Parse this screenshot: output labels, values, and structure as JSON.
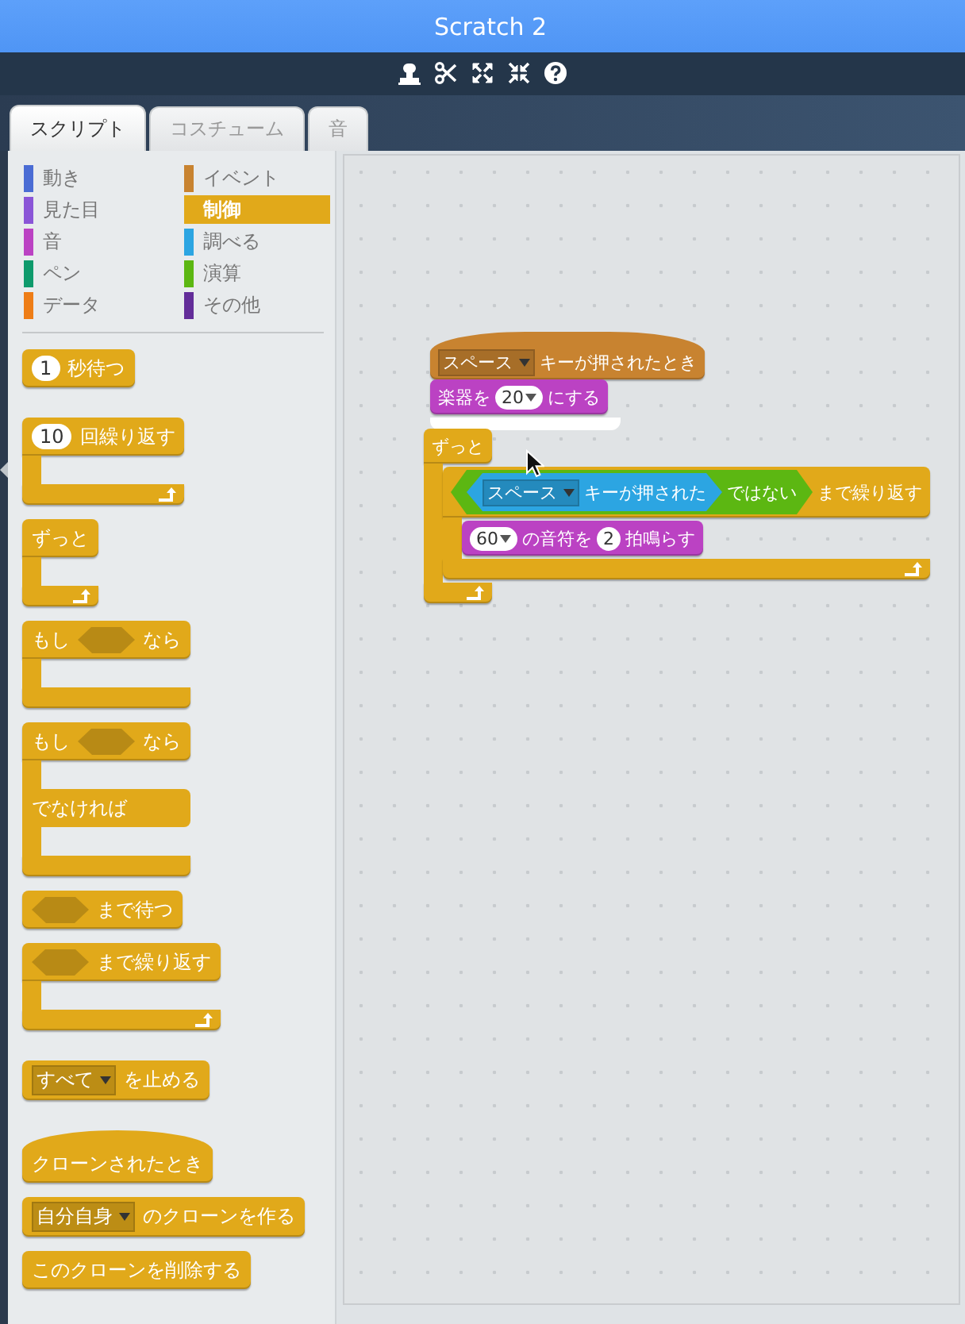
{
  "window": {
    "title": "Scratch 2"
  },
  "tabs": [
    {
      "label": "スクリプト",
      "selected": true
    },
    {
      "label": "コスチューム",
      "selected": false
    },
    {
      "label": "音",
      "selected": false
    }
  ],
  "categories": [
    {
      "label": "動き",
      "color": "#4a6cd4",
      "selected": false
    },
    {
      "label": "見た目",
      "color": "#8a55d7",
      "selected": false
    },
    {
      "label": "音",
      "color": "#bb42c3",
      "selected": false
    },
    {
      "label": "ペン",
      "color": "#0e9a6c",
      "selected": false
    },
    {
      "label": "データ",
      "color": "#ee7d16",
      "selected": false
    },
    {
      "label": "イベント",
      "color": "#c88330",
      "selected": false
    },
    {
      "label": "制御",
      "color": "#e1a91a",
      "selected": true
    },
    {
      "label": "調べる",
      "color": "#2ca5e2",
      "selected": false
    },
    {
      "label": "演算",
      "color": "#5cb712",
      "selected": false
    },
    {
      "label": "その他",
      "color": "#632d99",
      "selected": false
    }
  ],
  "palette_groups": [
    [
      {
        "kind": "stack",
        "color": "#e1a91a",
        "parts": [
          {
            "kind": "number",
            "text": "1"
          },
          {
            "kind": "text",
            "text": "秒待つ"
          }
        ]
      }
    ],
    [
      {
        "kind": "c",
        "color": "#e1a91a",
        "loop": true,
        "parts": [
          {
            "kind": "number",
            "text": "10"
          },
          {
            "kind": "text",
            "text": "回繰り返す"
          }
        ]
      },
      {
        "kind": "c",
        "color": "#e1a91a",
        "loop": true,
        "parts": [
          {
            "kind": "text",
            "text": "ずっと"
          }
        ]
      },
      {
        "kind": "c",
        "color": "#e1a91a",
        "loop": false,
        "parts": [
          {
            "kind": "text",
            "text": "もし"
          },
          {
            "kind": "slot"
          },
          {
            "kind": "text",
            "text": "なら"
          }
        ]
      },
      {
        "kind": "c",
        "color": "#e1a91a",
        "loop": false,
        "parts": [
          {
            "kind": "text",
            "text": "もし"
          },
          {
            "kind": "slot"
          },
          {
            "kind": "text",
            "text": "なら"
          }
        ],
        "else_parts": [
          {
            "kind": "text",
            "text": "でなければ"
          }
        ]
      },
      {
        "kind": "stack",
        "color": "#e1a91a",
        "parts": [
          {
            "kind": "slot"
          },
          {
            "kind": "text",
            "text": "まで待つ"
          }
        ]
      },
      {
        "kind": "c",
        "color": "#e1a91a",
        "loop": true,
        "parts": [
          {
            "kind": "slot"
          },
          {
            "kind": "text",
            "text": "まで繰り返す"
          }
        ]
      }
    ],
    [
      {
        "kind": "stack",
        "color": "#e1a91a",
        "parts": [
          {
            "kind": "menu",
            "text": "すべて"
          },
          {
            "kind": "text",
            "text": "を止める"
          }
        ]
      }
    ],
    [
      {
        "kind": "hat",
        "color": "#e1a91a",
        "parts": [
          {
            "kind": "text",
            "text": "クローンされたとき"
          }
        ]
      },
      {
        "kind": "stack",
        "color": "#e1a91a",
        "parts": [
          {
            "kind": "menu",
            "text": "自分自身"
          },
          {
            "kind": "text",
            "text": "のクローンを作る"
          }
        ]
      },
      {
        "kind": "stack",
        "color": "#e1a91a",
        "parts": [
          {
            "kind": "text",
            "text": "このクローンを削除する"
          }
        ]
      }
    ]
  ],
  "scripts": [
    [
      {
        "kind": "hat",
        "color": "#c88330",
        "parts": [
          {
            "kind": "menu",
            "text": "スペース"
          },
          {
            "kind": "text",
            "text": "キーが押されたとき"
          }
        ]
      },
      {
        "kind": "stack",
        "color": "#bb42c3",
        "parts": [
          {
            "kind": "text",
            "text": "楽器を"
          },
          {
            "kind": "number_menu",
            "text": "20"
          },
          {
            "kind": "text",
            "text": "にする"
          }
        ]
      }
    ],
    [
      {
        "kind": "c",
        "color": "#e1a91a",
        "loop": true,
        "parts": [
          {
            "kind": "text",
            "text": "ずっと"
          }
        ],
        "body": [
          {
            "kind": "c",
            "color": "#e1a91a",
            "loop": true,
            "parts": [
              {
                "kind": "predicate",
                "color": "#5cb712",
                "parts": [
                  {
                    "kind": "predicate",
                    "color": "#2ca5e2",
                    "parts": [
                      {
                        "kind": "menu",
                        "text": "スペース"
                      },
                      {
                        "kind": "text",
                        "text": "キーが押された"
                      }
                    ]
                  },
                  {
                    "kind": "text",
                    "text": "ではない"
                  }
                ]
              },
              {
                "kind": "text",
                "text": "まで繰り返す"
              }
            ],
            "body": [
              {
                "kind": "stack",
                "color": "#bb42c3",
                "parts": [
                  {
                    "kind": "number_menu",
                    "text": "60"
                  },
                  {
                    "kind": "text",
                    "text": "の音符を"
                  },
                  {
                    "kind": "number",
                    "text": "2"
                  },
                  {
                    "kind": "text",
                    "text": "拍鳴らす"
                  }
                ]
              }
            ]
          }
        ]
      }
    ]
  ]
}
